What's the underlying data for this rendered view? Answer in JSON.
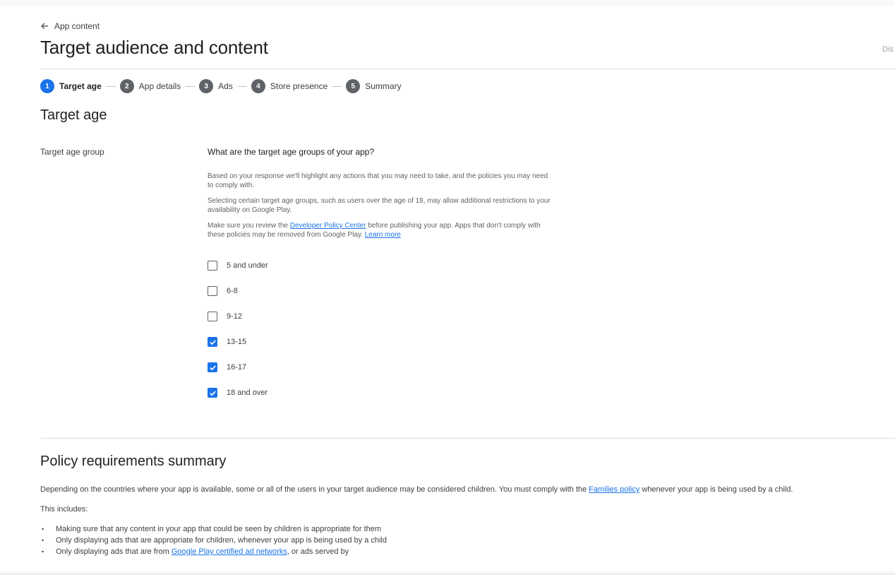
{
  "header": {
    "back_label": "App content",
    "title": "Target audience and content",
    "right_edge_text": "Dis"
  },
  "stepper": {
    "steps": [
      {
        "num": "1",
        "label": "Target age",
        "active": true
      },
      {
        "num": "2",
        "label": "App details",
        "active": false
      },
      {
        "num": "3",
        "label": "Ads",
        "active": false
      },
      {
        "num": "4",
        "label": "Store presence",
        "active": false
      },
      {
        "num": "5",
        "label": "Summary",
        "active": false
      }
    ]
  },
  "target_age": {
    "section_title": "Target age",
    "field_label": "Target age group",
    "question": "What are the target age groups of your app?",
    "help1": "Based on your response we'll highlight any actions that you may need to take, and the policies you may need to comply with.",
    "help2": "Selecting certain target age groups, such as users over the age of 18, may allow additional restrictions to your availability on Google Play.",
    "help3_before": "Make sure you review the ",
    "help3_link": "Developer Policy Center",
    "help3_after": " before publishing your app. Apps that don't comply with these policies may be removed from Google Play. ",
    "help3_learn": "Learn more",
    "options": [
      {
        "label": "5 and under",
        "checked": false
      },
      {
        "label": "6-8",
        "checked": false
      },
      {
        "label": "9-12",
        "checked": false
      },
      {
        "label": "13-15",
        "checked": true
      },
      {
        "label": "16-17",
        "checked": true
      },
      {
        "label": "18 and over",
        "checked": true
      }
    ]
  },
  "policy": {
    "title": "Policy requirements summary",
    "para1_before": "Depending on the countries where your app is available, some or all of the users in your target audience may be considered children. You must comply with the ",
    "para1_link": "Families policy",
    "para1_after": " whenever your app is being used by a child.",
    "includes": "This includes:",
    "bullet1": "Making sure that any content in your app that could be seen by children is appropriate for them",
    "bullet2": "Only displaying ads that are appropriate for children, whenever your app is being used by a child",
    "bullet3_before": "Only displaying ads that are from ",
    "bullet3_link": "Google Play certified ad networks",
    "bullet3_after": ", or ads served by"
  },
  "colors": {
    "accent": "#1a73e8",
    "step_inactive": "#5f6368",
    "divider": "#dadce0"
  }
}
